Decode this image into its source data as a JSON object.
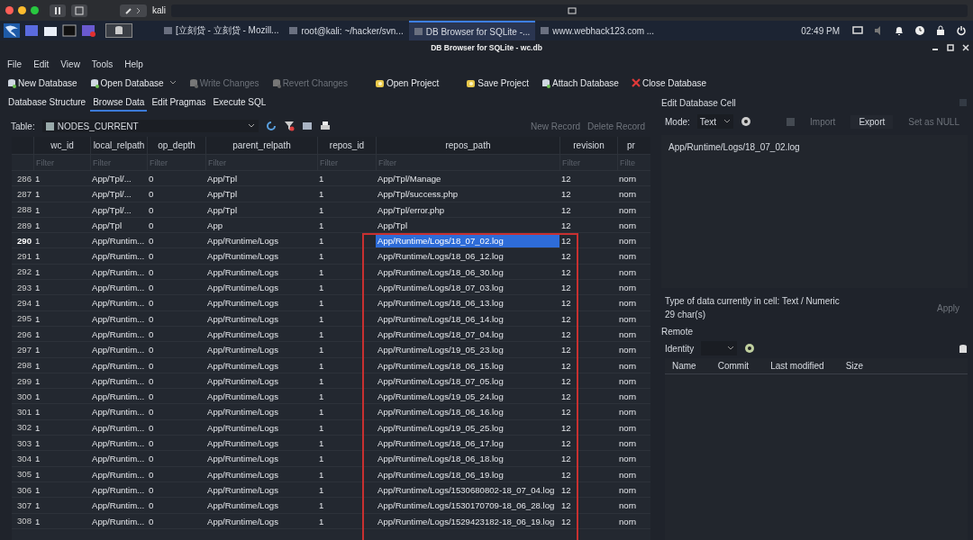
{
  "mac_bar": {
    "title": "kali"
  },
  "taskbar": {
    "tasks": [
      {
        "label": "[立刻贷 - 立刻贷 - Mozill...",
        "selected": false
      },
      {
        "label": "root@kali: ~/hacker/svn...",
        "selected": false
      },
      {
        "label": "DB Browser for SQLite -...",
        "selected": true
      },
      {
        "label": "www.webhack123.com ...",
        "selected": false
      }
    ],
    "clock": "02:49 PM"
  },
  "window": {
    "title": "DB Browser for SQLite - wc.db"
  },
  "menu": [
    "File",
    "Edit",
    "View",
    "Tools",
    "Help"
  ],
  "toolbar": [
    {
      "label": "New Database",
      "disabled": false,
      "kind": "db"
    },
    {
      "label": "Open Database",
      "disabled": false,
      "kind": "db-drop"
    },
    {
      "label": "Write Changes",
      "disabled": true,
      "kind": "db"
    },
    {
      "label": "Revert Changes",
      "disabled": true,
      "kind": "db"
    },
    {
      "label": "Open Project",
      "disabled": false,
      "kind": "project"
    },
    {
      "label": "Save Project",
      "disabled": false,
      "kind": "project"
    },
    {
      "label": "Attach Database",
      "disabled": false,
      "kind": "db"
    },
    {
      "label": "Close Database",
      "disabled": false,
      "kind": "close"
    }
  ],
  "tabs": [
    {
      "label": "Database Structure",
      "selected": false
    },
    {
      "label": "Browse Data",
      "selected": true
    },
    {
      "label": "Edit Pragmas",
      "selected": false
    },
    {
      "label": "Execute SQL",
      "selected": false
    }
  ],
  "table_bar": {
    "label": "Table:",
    "table": "NODES_CURRENT",
    "new_record": "New Record",
    "delete_record": "Delete Record"
  },
  "table": {
    "columns": [
      {
        "label": "wc_id",
        "filter_placeholder": "Filter"
      },
      {
        "label": "local_relpath",
        "filter_placeholder": "Filter"
      },
      {
        "label": "op_depth",
        "filter_placeholder": "Filter"
      },
      {
        "label": "parent_relpath",
        "filter_placeholder": "Filter"
      },
      {
        "label": "repos_id",
        "filter_placeholder": "Filter"
      },
      {
        "label": "repos_path",
        "filter_placeholder": "Filter"
      },
      {
        "label": "revision",
        "filter_placeholder": "Filter"
      },
      {
        "label": "pr",
        "filter_placeholder": "Filte"
      }
    ],
    "rows": [
      {
        "num": "286",
        "selected": false,
        "cell_selected": [
          false,
          false,
          false,
          false,
          false,
          false,
          false,
          false
        ],
        "cells": [
          "1",
          "App/Tpl/...",
          "0",
          "App/Tpl",
          "1",
          "App/Tpl/Manage",
          "12",
          "norn"
        ]
      },
      {
        "num": "287",
        "selected": false,
        "cell_selected": [
          false,
          false,
          false,
          false,
          false,
          false,
          false,
          false
        ],
        "cells": [
          "1",
          "App/Tpl/...",
          "0",
          "App/Tpl",
          "1",
          "App/Tpl/success.php",
          "12",
          "norn"
        ]
      },
      {
        "num": "288",
        "selected": false,
        "cell_selected": [
          false,
          false,
          false,
          false,
          false,
          false,
          false,
          false
        ],
        "cells": [
          "1",
          "App/Tpl/...",
          "0",
          "App/Tpl",
          "1",
          "App/Tpl/error.php",
          "12",
          "norn"
        ]
      },
      {
        "num": "289",
        "selected": false,
        "cell_selected": [
          false,
          false,
          false,
          false,
          false,
          false,
          false,
          false
        ],
        "cells": [
          "1",
          "App/Tpl",
          "0",
          "App",
          "1",
          "App/Tpl",
          "12",
          "norn"
        ]
      },
      {
        "num": "290",
        "selected": true,
        "cell_selected": [
          false,
          false,
          false,
          false,
          false,
          true,
          false,
          false
        ],
        "cells": [
          "1",
          "App/Runtim...",
          "0",
          "App/Runtime/Logs",
          "1",
          "App/Runtime/Logs/18_07_02.log",
          "12",
          "norn"
        ]
      },
      {
        "num": "291",
        "selected": false,
        "cell_selected": [
          false,
          false,
          false,
          false,
          false,
          false,
          false,
          false
        ],
        "cells": [
          "1",
          "App/Runtim...",
          "0",
          "App/Runtime/Logs",
          "1",
          "App/Runtime/Logs/18_06_12.log",
          "12",
          "norn"
        ]
      },
      {
        "num": "292",
        "selected": false,
        "cell_selected": [
          false,
          false,
          false,
          false,
          false,
          false,
          false,
          false
        ],
        "cells": [
          "1",
          "App/Runtim...",
          "0",
          "App/Runtime/Logs",
          "1",
          "App/Runtime/Logs/18_06_30.log",
          "12",
          "norn"
        ]
      },
      {
        "num": "293",
        "selected": false,
        "cell_selected": [
          false,
          false,
          false,
          false,
          false,
          false,
          false,
          false
        ],
        "cells": [
          "1",
          "App/Runtim...",
          "0",
          "App/Runtime/Logs",
          "1",
          "App/Runtime/Logs/18_07_03.log",
          "12",
          "norn"
        ]
      },
      {
        "num": "294",
        "selected": false,
        "cell_selected": [
          false,
          false,
          false,
          false,
          false,
          false,
          false,
          false
        ],
        "cells": [
          "1",
          "App/Runtim...",
          "0",
          "App/Runtime/Logs",
          "1",
          "App/Runtime/Logs/18_06_13.log",
          "12",
          "norn"
        ]
      },
      {
        "num": "295",
        "selected": false,
        "cell_selected": [
          false,
          false,
          false,
          false,
          false,
          false,
          false,
          false
        ],
        "cells": [
          "1",
          "App/Runtim...",
          "0",
          "App/Runtime/Logs",
          "1",
          "App/Runtime/Logs/18_06_14.log",
          "12",
          "norn"
        ]
      },
      {
        "num": "296",
        "selected": false,
        "cell_selected": [
          false,
          false,
          false,
          false,
          false,
          false,
          false,
          false
        ],
        "cells": [
          "1",
          "App/Runtim...",
          "0",
          "App/Runtime/Logs",
          "1",
          "App/Runtime/Logs/18_07_04.log",
          "12",
          "norn"
        ]
      },
      {
        "num": "297",
        "selected": false,
        "cell_selected": [
          false,
          false,
          false,
          false,
          false,
          false,
          false,
          false
        ],
        "cells": [
          "1",
          "App/Runtim...",
          "0",
          "App/Runtime/Logs",
          "1",
          "App/Runtime/Logs/19_05_23.log",
          "12",
          "norn"
        ]
      },
      {
        "num": "298",
        "selected": false,
        "cell_selected": [
          false,
          false,
          false,
          false,
          false,
          false,
          false,
          false
        ],
        "cells": [
          "1",
          "App/Runtim...",
          "0",
          "App/Runtime/Logs",
          "1",
          "App/Runtime/Logs/18_06_15.log",
          "12",
          "norn"
        ]
      },
      {
        "num": "299",
        "selected": false,
        "cell_selected": [
          false,
          false,
          false,
          false,
          false,
          false,
          false,
          false
        ],
        "cells": [
          "1",
          "App/Runtim...",
          "0",
          "App/Runtime/Logs",
          "1",
          "App/Runtime/Logs/18_07_05.log",
          "12",
          "norn"
        ]
      },
      {
        "num": "300",
        "selected": false,
        "cell_selected": [
          false,
          false,
          false,
          false,
          false,
          false,
          false,
          false
        ],
        "cells": [
          "1",
          "App/Runtim...",
          "0",
          "App/Runtime/Logs",
          "1",
          "App/Runtime/Logs/19_05_24.log",
          "12",
          "norn"
        ]
      },
      {
        "num": "301",
        "selected": false,
        "cell_selected": [
          false,
          false,
          false,
          false,
          false,
          false,
          false,
          false
        ],
        "cells": [
          "1",
          "App/Runtim...",
          "0",
          "App/Runtime/Logs",
          "1",
          "App/Runtime/Logs/18_06_16.log",
          "12",
          "norn"
        ]
      },
      {
        "num": "302",
        "selected": false,
        "cell_selected": [
          false,
          false,
          false,
          false,
          false,
          false,
          false,
          false
        ],
        "cells": [
          "1",
          "App/Runtim...",
          "0",
          "App/Runtime/Logs",
          "1",
          "App/Runtime/Logs/19_05_25.log",
          "12",
          "norn"
        ]
      },
      {
        "num": "303",
        "selected": false,
        "cell_selected": [
          false,
          false,
          false,
          false,
          false,
          false,
          false,
          false
        ],
        "cells": [
          "1",
          "App/Runtim...",
          "0",
          "App/Runtime/Logs",
          "1",
          "App/Runtime/Logs/18_06_17.log",
          "12",
          "norn"
        ]
      },
      {
        "num": "304",
        "selected": false,
        "cell_selected": [
          false,
          false,
          false,
          false,
          false,
          false,
          false,
          false
        ],
        "cells": [
          "1",
          "App/Runtim...",
          "0",
          "App/Runtime/Logs",
          "1",
          "App/Runtime/Logs/18_06_18.log",
          "12",
          "norn"
        ]
      },
      {
        "num": "305",
        "selected": false,
        "cell_selected": [
          false,
          false,
          false,
          false,
          false,
          false,
          false,
          false
        ],
        "cells": [
          "1",
          "App/Runtim...",
          "0",
          "App/Runtime/Logs",
          "1",
          "App/Runtime/Logs/18_06_19.log",
          "12",
          "norn"
        ]
      },
      {
        "num": "306",
        "selected": false,
        "cell_selected": [
          false,
          false,
          false,
          false,
          false,
          false,
          false,
          false
        ],
        "cells": [
          "1",
          "App/Runtim...",
          "0",
          "App/Runtime/Logs",
          "1",
          "App/Runtime/Logs/1530680802-18_07_04.log",
          "12",
          "norn"
        ]
      },
      {
        "num": "307",
        "selected": false,
        "cell_selected": [
          false,
          false,
          false,
          false,
          false,
          false,
          false,
          false
        ],
        "cells": [
          "1",
          "App/Runtim...",
          "0",
          "App/Runtime/Logs",
          "1",
          "App/Runtime/Logs/1530170709-18_06_28.log",
          "12",
          "norn"
        ]
      },
      {
        "num": "308",
        "selected": false,
        "cell_selected": [
          false,
          false,
          false,
          false,
          false,
          false,
          false,
          false
        ],
        "cells": [
          "1",
          "App/Runtim...",
          "0",
          "App/Runtime/Logs",
          "1",
          "App/Runtime/Logs/1529423182-18_06_19.log",
          "12",
          "norn"
        ]
      }
    ]
  },
  "edit_cell": {
    "title": "Edit Database Cell",
    "mode_label": "Mode:",
    "mode": "Text",
    "import": "Import",
    "export": "Export",
    "set_null": "Set as NULL",
    "value": "App/Runtime/Logs/18_07_02.log",
    "type_info": "Type of data currently in cell: Text / Numeric",
    "chars": "29 char(s)",
    "apply": "Apply"
  },
  "remote": {
    "title": "Remote",
    "identity_label": "Identity",
    "columns": [
      "Name",
      "Commit",
      "Last modified",
      "Size"
    ]
  }
}
